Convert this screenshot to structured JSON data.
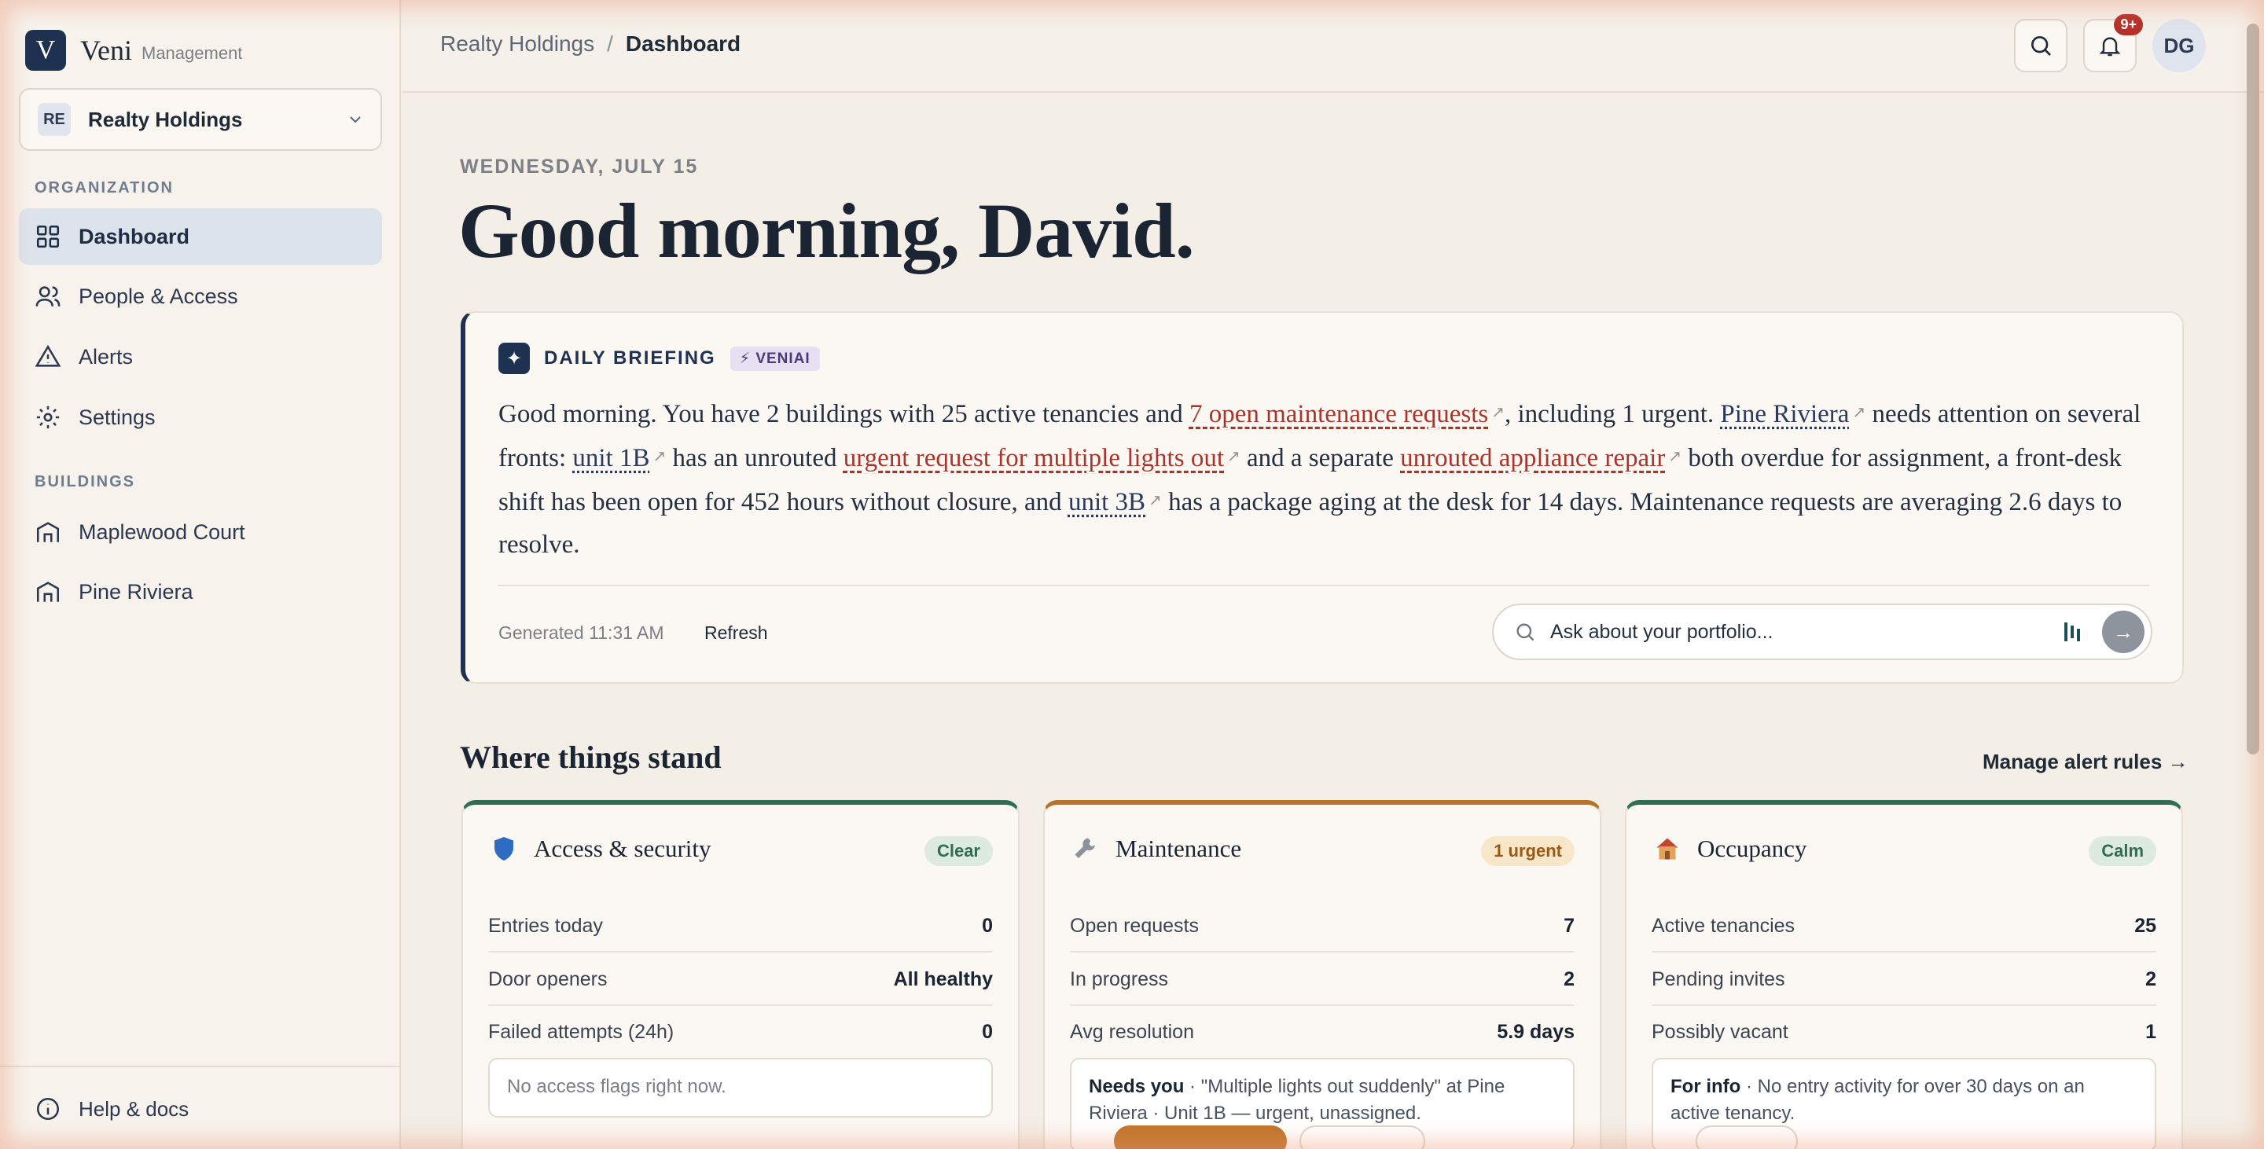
{
  "brand": {
    "logo_letter": "V",
    "name": "Veni",
    "sub": "Management"
  },
  "org": {
    "badge": "RE",
    "name": "Realty Holdings"
  },
  "sidebar": {
    "org_label": "ORGANIZATION",
    "items": [
      {
        "label": "Dashboard",
        "icon": "grid-icon",
        "active": true
      },
      {
        "label": "People & Access",
        "icon": "users-icon"
      },
      {
        "label": "Alerts",
        "icon": "alert-triangle-icon"
      },
      {
        "label": "Settings",
        "icon": "gear-icon"
      }
    ],
    "buildings_label": "BUILDINGS",
    "buildings": [
      {
        "label": "Maplewood Court",
        "icon": "building-icon"
      },
      {
        "label": "Pine Riviera",
        "icon": "building-icon"
      }
    ],
    "help": "Help & docs"
  },
  "topbar": {
    "breadcrumb": [
      "Realty Holdings",
      "Dashboard"
    ],
    "separator": "/",
    "notif_count": "9+",
    "avatar": "DG"
  },
  "main": {
    "date": "WEDNESDAY, JULY 15",
    "greeting": "Good morning, David."
  },
  "briefing": {
    "title": "DAILY BRIEFING",
    "tag": "⚡ VENIAI",
    "parts": {
      "t1": "Good morning. You have 2 buildings with 25 active tenancies and ",
      "l1": "7 open maintenance requests",
      "t2": ", including 1 urgent. ",
      "l2": "Pine Riviera",
      "t3": " needs attention on several fronts: ",
      "l3": "unit 1B",
      "t4": " has an unrouted ",
      "l4": "urgent request for multiple lights out",
      "t5": " and a separate ",
      "l5": "unrouted appliance repair",
      "t6": " both overdue for assignment, a front-desk shift has been open for 452 hours without closure, and ",
      "l6": "unit 3B",
      "t7": " has a package aging at the desk for 14 days. Maintenance requests are averaging 2.6 days to resolve."
    },
    "generated": "Generated 11:31 AM",
    "refresh": "Refresh",
    "ask_placeholder": "Ask about your portfolio..."
  },
  "section": {
    "title": "Where things stand",
    "link": "Manage alert rules →"
  },
  "cards": [
    {
      "title": "Access & security",
      "icon": "shield-icon",
      "pill": "Clear",
      "accent": "#2f6e4f",
      "pill_bg": "#dceadf",
      "pill_fg": "#2f6e4f",
      "rows": [
        {
          "label": "Entries today",
          "value": "0"
        },
        {
          "label": "Door openers",
          "value": "All healthy"
        },
        {
          "label": "Failed attempts (24h)",
          "value": "0"
        }
      ],
      "note_lead": "",
      "note": "No access flags right now."
    },
    {
      "title": "Maintenance",
      "icon": "wrench-icon",
      "pill": "1 urgent",
      "accent": "#b8722a",
      "pill_bg": "#f8e6c8",
      "pill_fg": "#9a5a14",
      "rows": [
        {
          "label": "Open requests",
          "value": "7"
        },
        {
          "label": "In progress",
          "value": "2"
        },
        {
          "label": "Avg resolution",
          "value": "5.9 days"
        }
      ],
      "note_lead": "Needs you",
      "note": " · \"Multiple lights out suddenly\" at Pine Riviera · Unit 1B — urgent, unassigned."
    },
    {
      "title": "Occupancy",
      "icon": "house-icon",
      "pill": "Calm",
      "accent": "#2f6e4f",
      "pill_bg": "#dceadf",
      "pill_fg": "#2f6e4f",
      "rows": [
        {
          "label": "Active tenancies",
          "value": "25"
        },
        {
          "label": "Pending invites",
          "value": "2"
        },
        {
          "label": "Possibly vacant",
          "value": "1"
        }
      ],
      "note_lead": "For info",
      "note": " · No entry activity for over 30 days on an active tenancy."
    }
  ]
}
